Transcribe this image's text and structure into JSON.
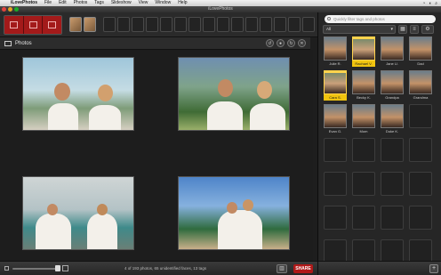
{
  "menubar": {
    "app_name": "iLovePhotos",
    "items": [
      "File",
      "Edit",
      "Photos",
      "Tags",
      "Slideshow",
      "View",
      "Window",
      "Help"
    ]
  },
  "window": {
    "title": "iLovePhotos"
  },
  "panel": {
    "title": "Photos"
  },
  "status": {
    "text": "4 of 193 photos, 65 unidentified faces, 13 tags",
    "share_label": "SHARE"
  },
  "right_panel": {
    "search_placeholder": "Quickly filter tags and photos",
    "filter_value": "All",
    "faces": [
      {
        "name": "Julie R.",
        "selected": false
      },
      {
        "name": "Rachael V.",
        "selected": true
      },
      {
        "name": "Jane U.",
        "selected": false
      },
      {
        "name": "Dad",
        "selected": false
      },
      {
        "name": "Cara S.",
        "selected": true
      },
      {
        "name": "Becky K.",
        "selected": false
      },
      {
        "name": "Grandpa",
        "selected": false
      },
      {
        "name": "Grandma",
        "selected": false
      },
      {
        "name": "Evan G.",
        "selected": false
      },
      {
        "name": "Mom",
        "selected": false
      },
      {
        "name": "Duke K.",
        "selected": false
      }
    ]
  },
  "colors": {
    "accent": "#b01818",
    "selection": "#f1c40f",
    "background": "#1e1e1e"
  }
}
